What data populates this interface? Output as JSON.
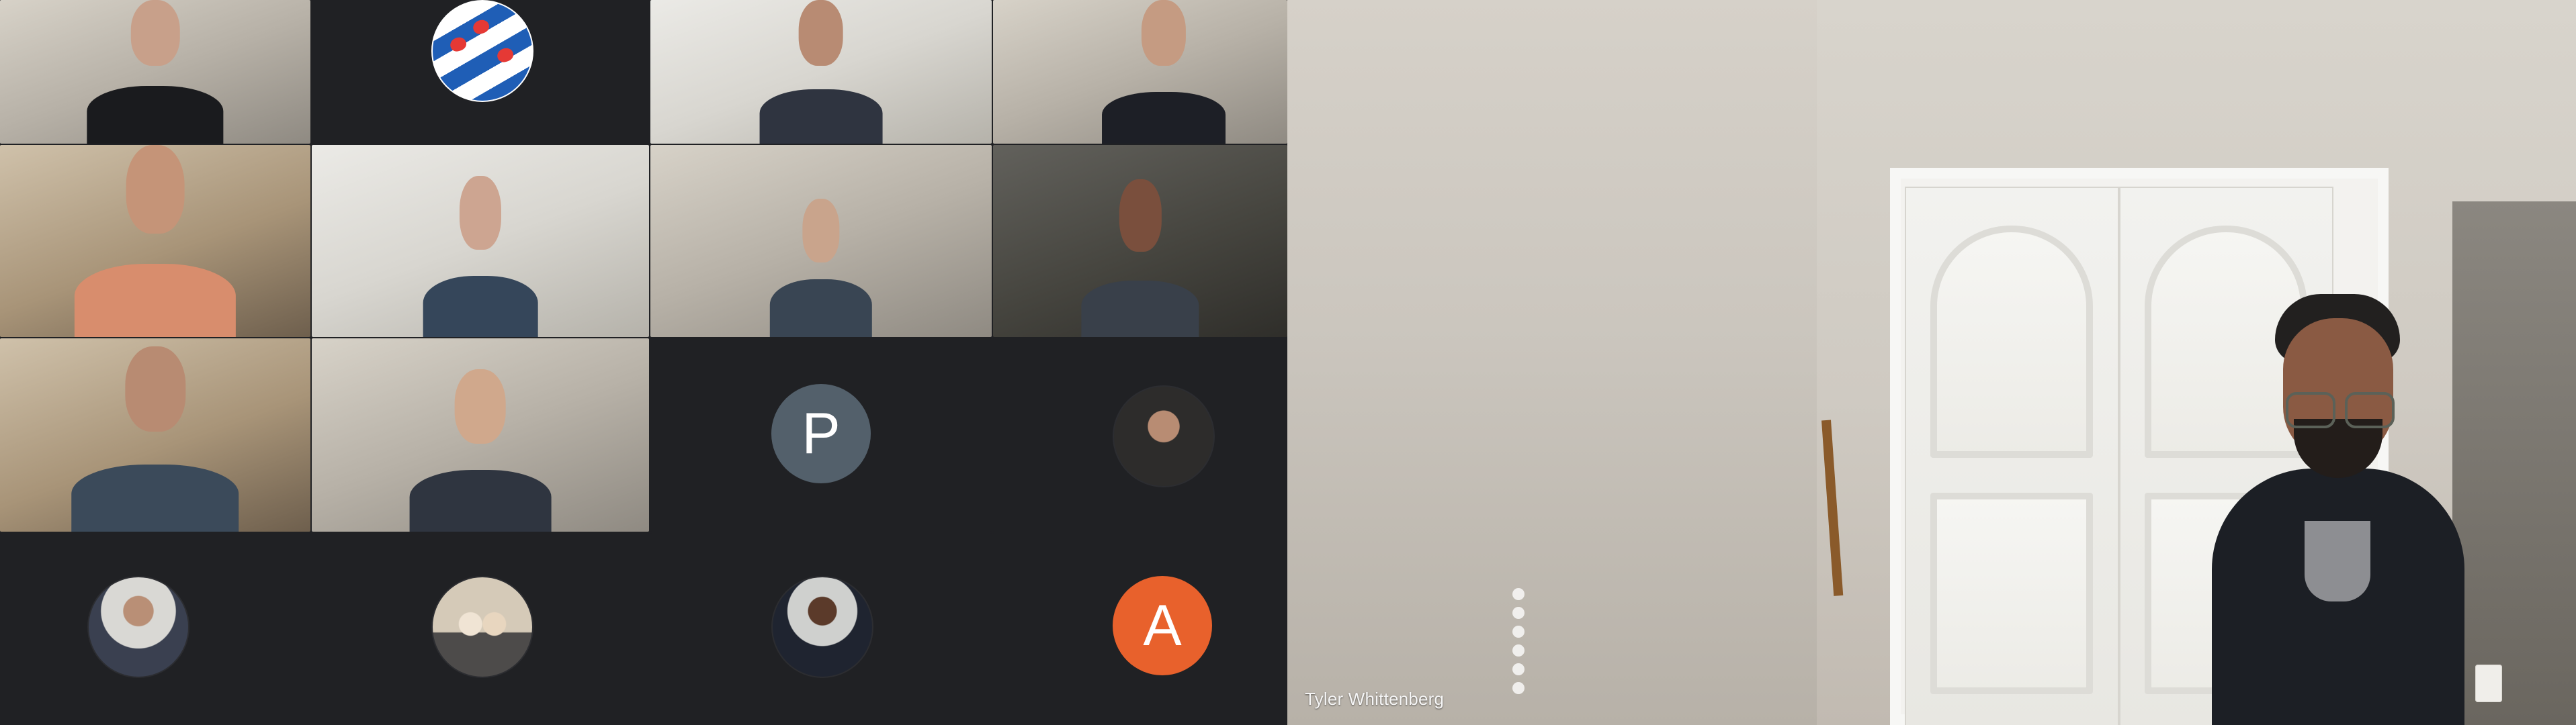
{
  "app": {
    "title": "",
    "featured_speaker_name": "Tyler Whittenberg"
  },
  "participants": [
    {
      "name": "",
      "kind": "video"
    },
    {
      "name": "",
      "kind": "flag-avatar"
    },
    {
      "name": "",
      "kind": "video"
    },
    {
      "name": "",
      "kind": "video"
    },
    {
      "name": "",
      "kind": "video"
    },
    {
      "name": "",
      "kind": "video"
    },
    {
      "name": "",
      "kind": "video"
    },
    {
      "name": "",
      "kind": "video"
    },
    {
      "name": "",
      "kind": "video"
    },
    {
      "name": "",
      "kind": "video"
    },
    {
      "name": "",
      "kind": "letter-avatar",
      "letter": "P"
    },
    {
      "name": "",
      "kind": "photo-avatar"
    },
    {
      "name": "",
      "kind": "photo-avatar"
    },
    {
      "name": "",
      "kind": "photo-avatar"
    },
    {
      "name": "",
      "kind": "photo-avatar"
    },
    {
      "name": "",
      "kind": "letter-avatar",
      "letter": "A"
    }
  ],
  "colors": {
    "background": "#202124",
    "avatar_p": "#53606b",
    "avatar_a": "#e8612c",
    "text": "#f5f5f5"
  },
  "icons": {
    "participant_avatar": "avatar-icon",
    "audio_indicator": "audio-level-icon"
  }
}
